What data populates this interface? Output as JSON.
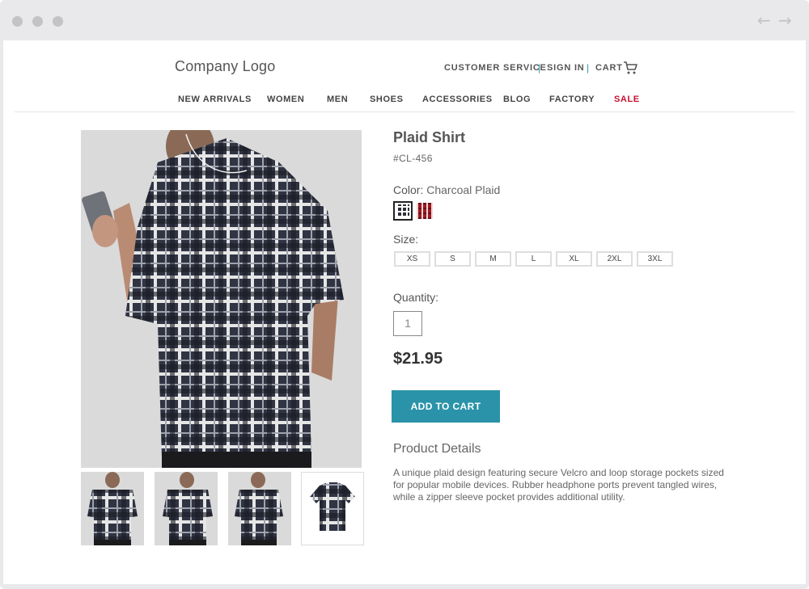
{
  "browser": {
    "icons": [
      "window-dot",
      "back-arrow-icon",
      "forward-arrow-icon"
    ]
  },
  "header": {
    "logo": "Company Logo",
    "utility": {
      "customer_service": "CUSTOMER SERVICE",
      "sign_in": "SIGN IN",
      "cart": "CART",
      "separator": "|"
    },
    "nav": [
      "NEW ARRIVALS",
      "WOMEN",
      "MEN",
      "SHOES",
      "ACCESSORIES",
      "BLOG",
      "FACTORY",
      "SALE"
    ]
  },
  "product": {
    "title": "Plaid Shirt",
    "sku": "#CL-456",
    "color_label": "Color:",
    "color_value": "Charcoal Plaid",
    "swatches": [
      "Charcoal Plaid",
      "Red Plaid"
    ],
    "size_label": "Size:",
    "sizes": [
      "XS",
      "S",
      "M",
      "L",
      "XL",
      "2XL",
      "3XL"
    ],
    "quantity_label": "Quantity:",
    "quantity_value": "1",
    "price": "$21.95",
    "add_to_cart": "ADD TO CART",
    "details_heading": "Product Details",
    "details_text": "A unique plaid design featuring secure Velcro and loop storage pockets sized for popular mobile devices. Rubber headphone ports prevent tangled wires, while a zipper sleeve pocket provides additional utility."
  },
  "colors": {
    "accent": "#2a93a9",
    "sale": "#c8102e",
    "separator": "#2a93b0"
  }
}
